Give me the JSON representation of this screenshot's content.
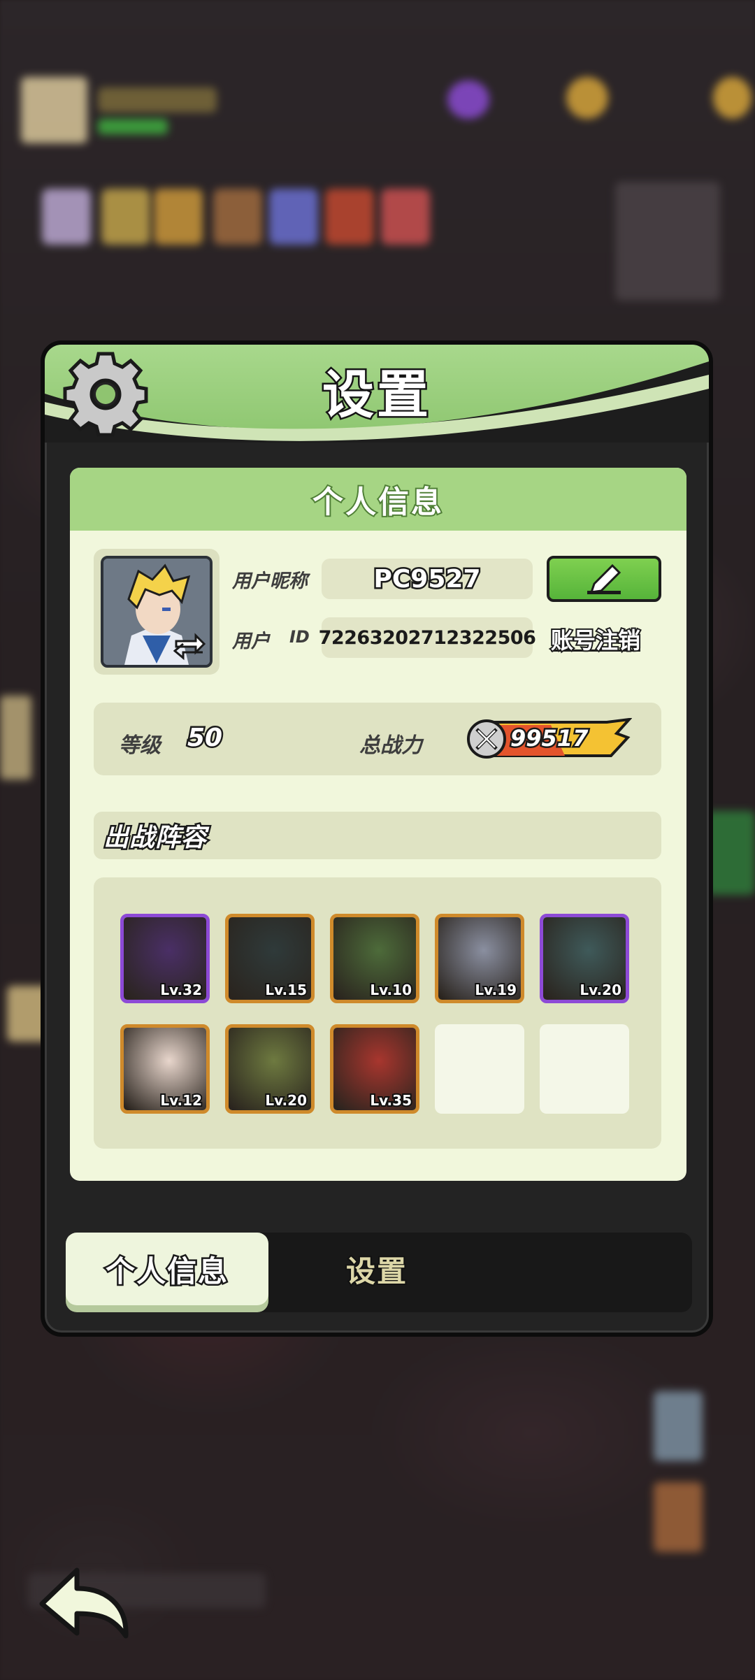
{
  "panel": {
    "title": "设置",
    "section_title": "个人信息"
  },
  "profile": {
    "nickname_label": "用户昵称",
    "nickname": "PC9527",
    "id_label_prefix": "用户",
    "id_label_suffix": "ID",
    "user_id": "72263202712322506",
    "cancel_account": "账号注销",
    "edit_icon": "pencil-icon",
    "swap_icon": "swap-arrows-icon"
  },
  "stats": {
    "level_label": "等级",
    "level": "50",
    "power_label": "总战力",
    "power": "99517",
    "power_icon": "crossed-swords-icon"
  },
  "team": {
    "title": "出战阵容",
    "heroes": [
      {
        "level": "Lv.32",
        "rarity": "epic",
        "color": "#4a2f66"
      },
      {
        "level": "Lv.15",
        "rarity": "rare",
        "color": "#2f3a3a"
      },
      {
        "level": "Lv.10",
        "rarity": "rare",
        "color": "#4d6b3a"
      },
      {
        "level": "Lv.19",
        "rarity": "rare",
        "color": "#8a8fa0"
      },
      {
        "level": "Lv.20",
        "rarity": "epic",
        "color": "#3f5a5a"
      },
      {
        "level": "Lv.12",
        "rarity": "rare",
        "color": "#e8d6cc"
      },
      {
        "level": "Lv.20",
        "rarity": "rare",
        "color": "#6e7a40"
      },
      {
        "level": "Lv.35",
        "rarity": "rare",
        "color": "#a8362e"
      }
    ],
    "empty_slots": 2
  },
  "tabs": {
    "personal": "个人信息",
    "settings": "设置"
  },
  "colors": {
    "header_green": "#8cc56e",
    "card_bg": "#f1f7dc",
    "edit_green": "#56b43a",
    "rare_border": "#cf8a2b",
    "epic_border": "#8d4ad6"
  }
}
